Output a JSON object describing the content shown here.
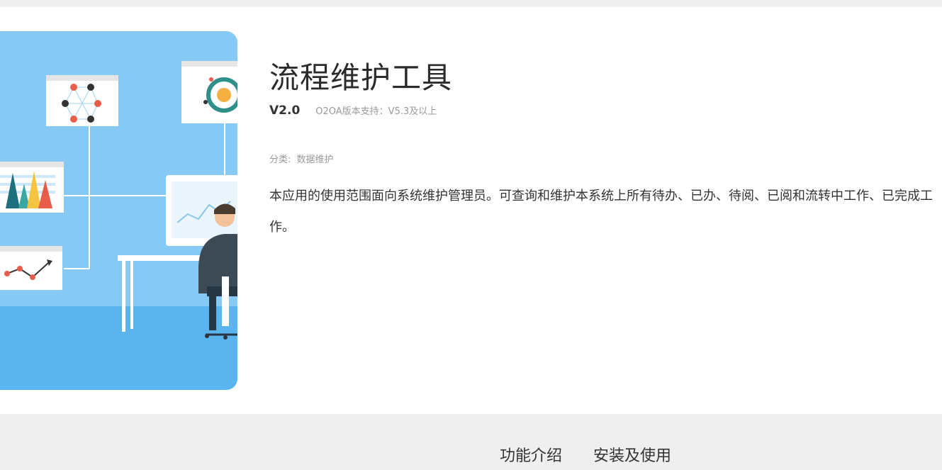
{
  "app": {
    "title": "流程维护工具",
    "version": "V2.0",
    "support": "O2OA版本支持：V5.3及以上",
    "category_label": "分类:",
    "category_value": "数据维护",
    "description": "本应用的使用范围面向系统维护管理员。可查询和维护本系统上所有待办、已办、待阅、已阅和流转中工作、已完成工作。",
    "cover_image": "workflow-maintenance-illustration"
  },
  "tabs": [
    {
      "label": "功能介绍"
    },
    {
      "label": "安装及使用"
    }
  ],
  "colors": {
    "cover_bg": "#87c9f5",
    "cover_floor": "#5ab5ef",
    "page_bg": "#efefef"
  }
}
